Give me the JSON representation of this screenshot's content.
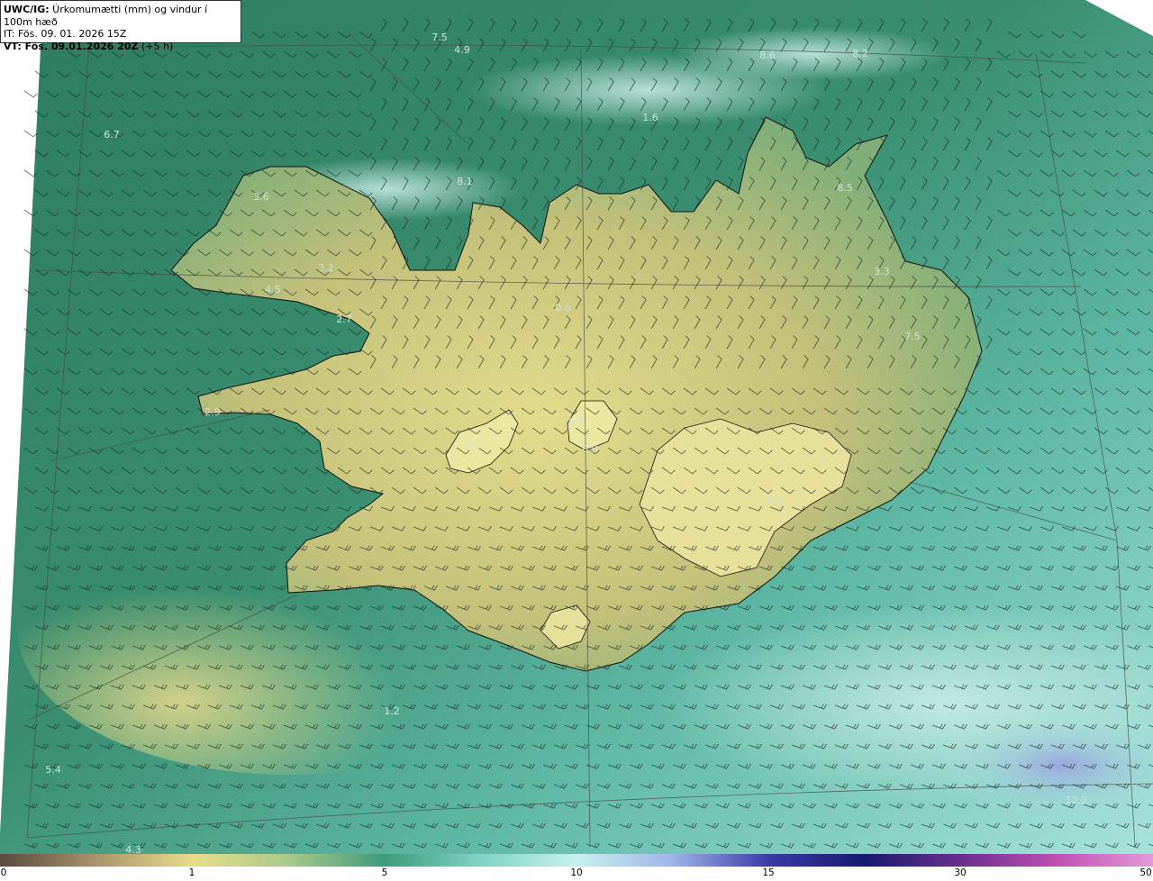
{
  "header": {
    "product_bold": "UWC/IG:",
    "product_desc": " Úrkomumætti (mm) og vindur í 100m hæð",
    "issue_time": "IT: Fös. 09. 01. 2026 15Z",
    "valid_time_bold": "VT: Fös. 09.01.2026 20Z",
    "valid_time_offset": " (+5 h)"
  },
  "colorbar": {
    "ticks": [
      {
        "label": "0",
        "value": 0
      },
      {
        "label": "1",
        "value": 1
      },
      {
        "label": "5",
        "value": 5
      },
      {
        "label": "10",
        "value": 10
      },
      {
        "label": "15",
        "value": 15
      },
      {
        "label": "30",
        "value": 30
      },
      {
        "label": "50",
        "value": 50
      }
    ],
    "colors": [
      "#5b4a3e",
      "#a8936b",
      "#e8dc8a",
      "#a9c98a",
      "#3f9a7a",
      "#7fd3c4",
      "#c7f1ee",
      "#9fb4e8",
      "#3a3aa8",
      "#171a6e",
      "#6a2e8e",
      "#c04fb4",
      "#e39ad8"
    ]
  },
  "map_labels": [
    {
      "text": "7.5"
    },
    {
      "text": "4.9"
    },
    {
      "text": "8.6"
    },
    {
      "text": "8.2"
    },
    {
      "text": "6.7"
    },
    {
      "text": "8.1"
    },
    {
      "text": "3.6"
    },
    {
      "text": "8.5"
    },
    {
      "text": "3.2"
    },
    {
      "text": "3.3"
    },
    {
      "text": "4.5"
    },
    {
      "text": "2.7"
    },
    {
      "text": "7.5"
    },
    {
      "text": "2.9"
    },
    {
      "text": "0.9"
    },
    {
      "text": "2.1"
    },
    {
      "text": "5.4"
    },
    {
      "text": "4.3"
    },
    {
      "text": "1.2"
    },
    {
      "text": "0.9"
    },
    {
      "text": "0.6"
    },
    {
      "text": "1.6"
    },
    {
      "text": "12.2"
    },
    {
      "text": "8.3"
    }
  ],
  "colors": {
    "ocean_deep": "#2f7e62",
    "ocean_light": "#8fd4c8",
    "land_low": "#c9c27a",
    "land_high": "#e6e090",
    "coast": "#1a1a1a"
  }
}
